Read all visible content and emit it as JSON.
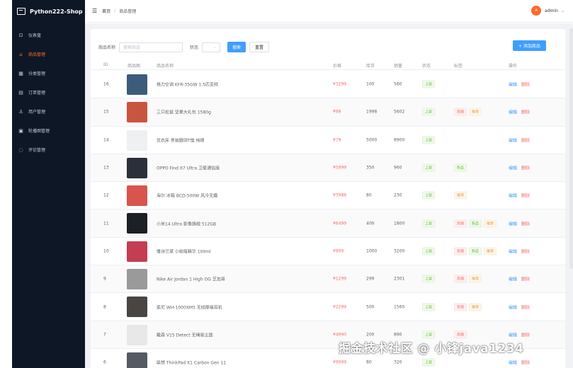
{
  "app": {
    "title": "Python222-Shop"
  },
  "sidebar": {
    "items": [
      {
        "label": "仪表盘",
        "icon": "dashboard-icon",
        "glyph": "⊡",
        "active": false
      },
      {
        "label": "商品管理",
        "icon": "shopping-bag-icon",
        "glyph": "⌂",
        "active": true
      },
      {
        "label": "分类管理",
        "icon": "grid-icon",
        "glyph": "▦",
        "active": false
      },
      {
        "label": "订单管理",
        "icon": "order-icon",
        "glyph": "▤",
        "active": false
      },
      {
        "label": "用户管理",
        "icon": "user-icon",
        "glyph": "♙",
        "active": false
      },
      {
        "label": "轮播图管理",
        "icon": "image-icon",
        "glyph": "▣",
        "active": false
      },
      {
        "label": "评论管理",
        "icon": "comment-icon",
        "glyph": "◌",
        "active": false
      }
    ]
  },
  "header": {
    "breadcrumb": {
      "home": "首页",
      "sep": "/",
      "current": "商品管理"
    },
    "user": {
      "avatar": "A",
      "name": "admin"
    }
  },
  "filter": {
    "name_label": "商品名称",
    "name_placeholder": "搜索商品",
    "status_label": "状态",
    "search_button": "搜索",
    "reset_button": "重置",
    "add_button": "+ 添加商品"
  },
  "table": {
    "columns": [
      "ID",
      "商品图",
      "商品名称",
      "价格",
      "库存",
      "销量",
      "状态",
      "标签",
      "操作"
    ],
    "edit_label": "编辑",
    "delete_label": "删除",
    "rows": [
      {
        "id": "16",
        "name": "格力空调 KFR-35GW 1.5匹变频",
        "price": "¥3299",
        "stock": "100",
        "sales": "560",
        "status": "上架",
        "tags": [],
        "thumb": "#3d5c7a"
      },
      {
        "id": "15",
        "name": "三只松鼠 坚果大礼包 1580g",
        "price": "¥99",
        "stock": "1998",
        "sales": "5602",
        "status": "上架",
        "tags": [
          {
            "t": "热销",
            "c": "red"
          },
          {
            "t": "推荐",
            "c": "orange"
          }
        ],
        "thumb": "#c8553d"
      },
      {
        "id": "14",
        "name": "优衣库 男装圆领T恤 纯棉",
        "price": "¥79",
        "stock": "5000",
        "sales": "8900",
        "status": "上架",
        "tags": [],
        "thumb": "#eef0f2"
      },
      {
        "id": "13",
        "name": "OPPO Find X7 Ultra 卫星通信版",
        "price": "¥5999",
        "stock": "350",
        "sales": "960",
        "status": "上架",
        "tags": [
          {
            "t": "新品",
            "c": "green"
          }
        ],
        "thumb": "#2b2f3a"
      },
      {
        "id": "12",
        "name": "海尔 冰箱 BCD-500W 风冷无霜",
        "price": "¥3988",
        "stock": "80",
        "sales": "230",
        "status": "上架",
        "tags": [
          {
            "t": "推荐",
            "c": "orange"
          }
        ],
        "thumb": "#d9534f"
      },
      {
        "id": "11",
        "name": "小米14 Ultra 影像旗舰 512GB",
        "price": "¥6499",
        "stock": "400",
        "sales": "1800",
        "status": "上架",
        "tags": [
          {
            "t": "热销",
            "c": "red"
          },
          {
            "t": "新品",
            "c": "green"
          },
          {
            "t": "推荐",
            "c": "orange"
          }
        ],
        "thumb": "#1c1f26"
      },
      {
        "id": "10",
        "name": "雅诗兰黛 小棕瓶精华 100ml",
        "price": "¥899",
        "stock": "1000",
        "sales": "3200",
        "status": "上架",
        "tags": [
          {
            "t": "热销",
            "c": "red"
          },
          {
            "t": "新品",
            "c": "green"
          },
          {
            "t": "推荐",
            "c": "orange"
          }
        ],
        "thumb": "#c43d52"
      },
      {
        "id": "9",
        "name": "Nike Air Jordan 1 High OG 芝加哥",
        "price": "¥1299",
        "stock": "299",
        "sales": "2301",
        "status": "上架",
        "tags": [
          {
            "t": "热销",
            "c": "red"
          },
          {
            "t": "推荐",
            "c": "orange"
          }
        ],
        "thumb": "#9a9a9a"
      },
      {
        "id": "8",
        "name": "索尼 WH-1000XM5 无线降噪耳机",
        "price": "¥2299",
        "stock": "500",
        "sales": "1560",
        "status": "上架",
        "tags": [
          {
            "t": "热销",
            "c": "red"
          },
          {
            "t": "推荐",
            "c": "orange"
          }
        ],
        "thumb": "#4a4540"
      },
      {
        "id": "7",
        "name": "戴森 V15 Detect 无绳吸尘器",
        "price": "¥4990",
        "stock": "200",
        "sales": "890",
        "status": "上架",
        "tags": [
          {
            "t": "热销",
            "c": "red"
          }
        ],
        "thumb": "#e8e8e8"
      },
      {
        "id": "6",
        "name": "联想 ThinkPad X1 Carbon Gen 11",
        "price": "¥9999",
        "stock": "80",
        "sales": "320",
        "status": "上架",
        "tags": [],
        "thumb": "#555b63"
      }
    ]
  },
  "watermark": "掘金技术社区 @ 小锋java1234"
}
